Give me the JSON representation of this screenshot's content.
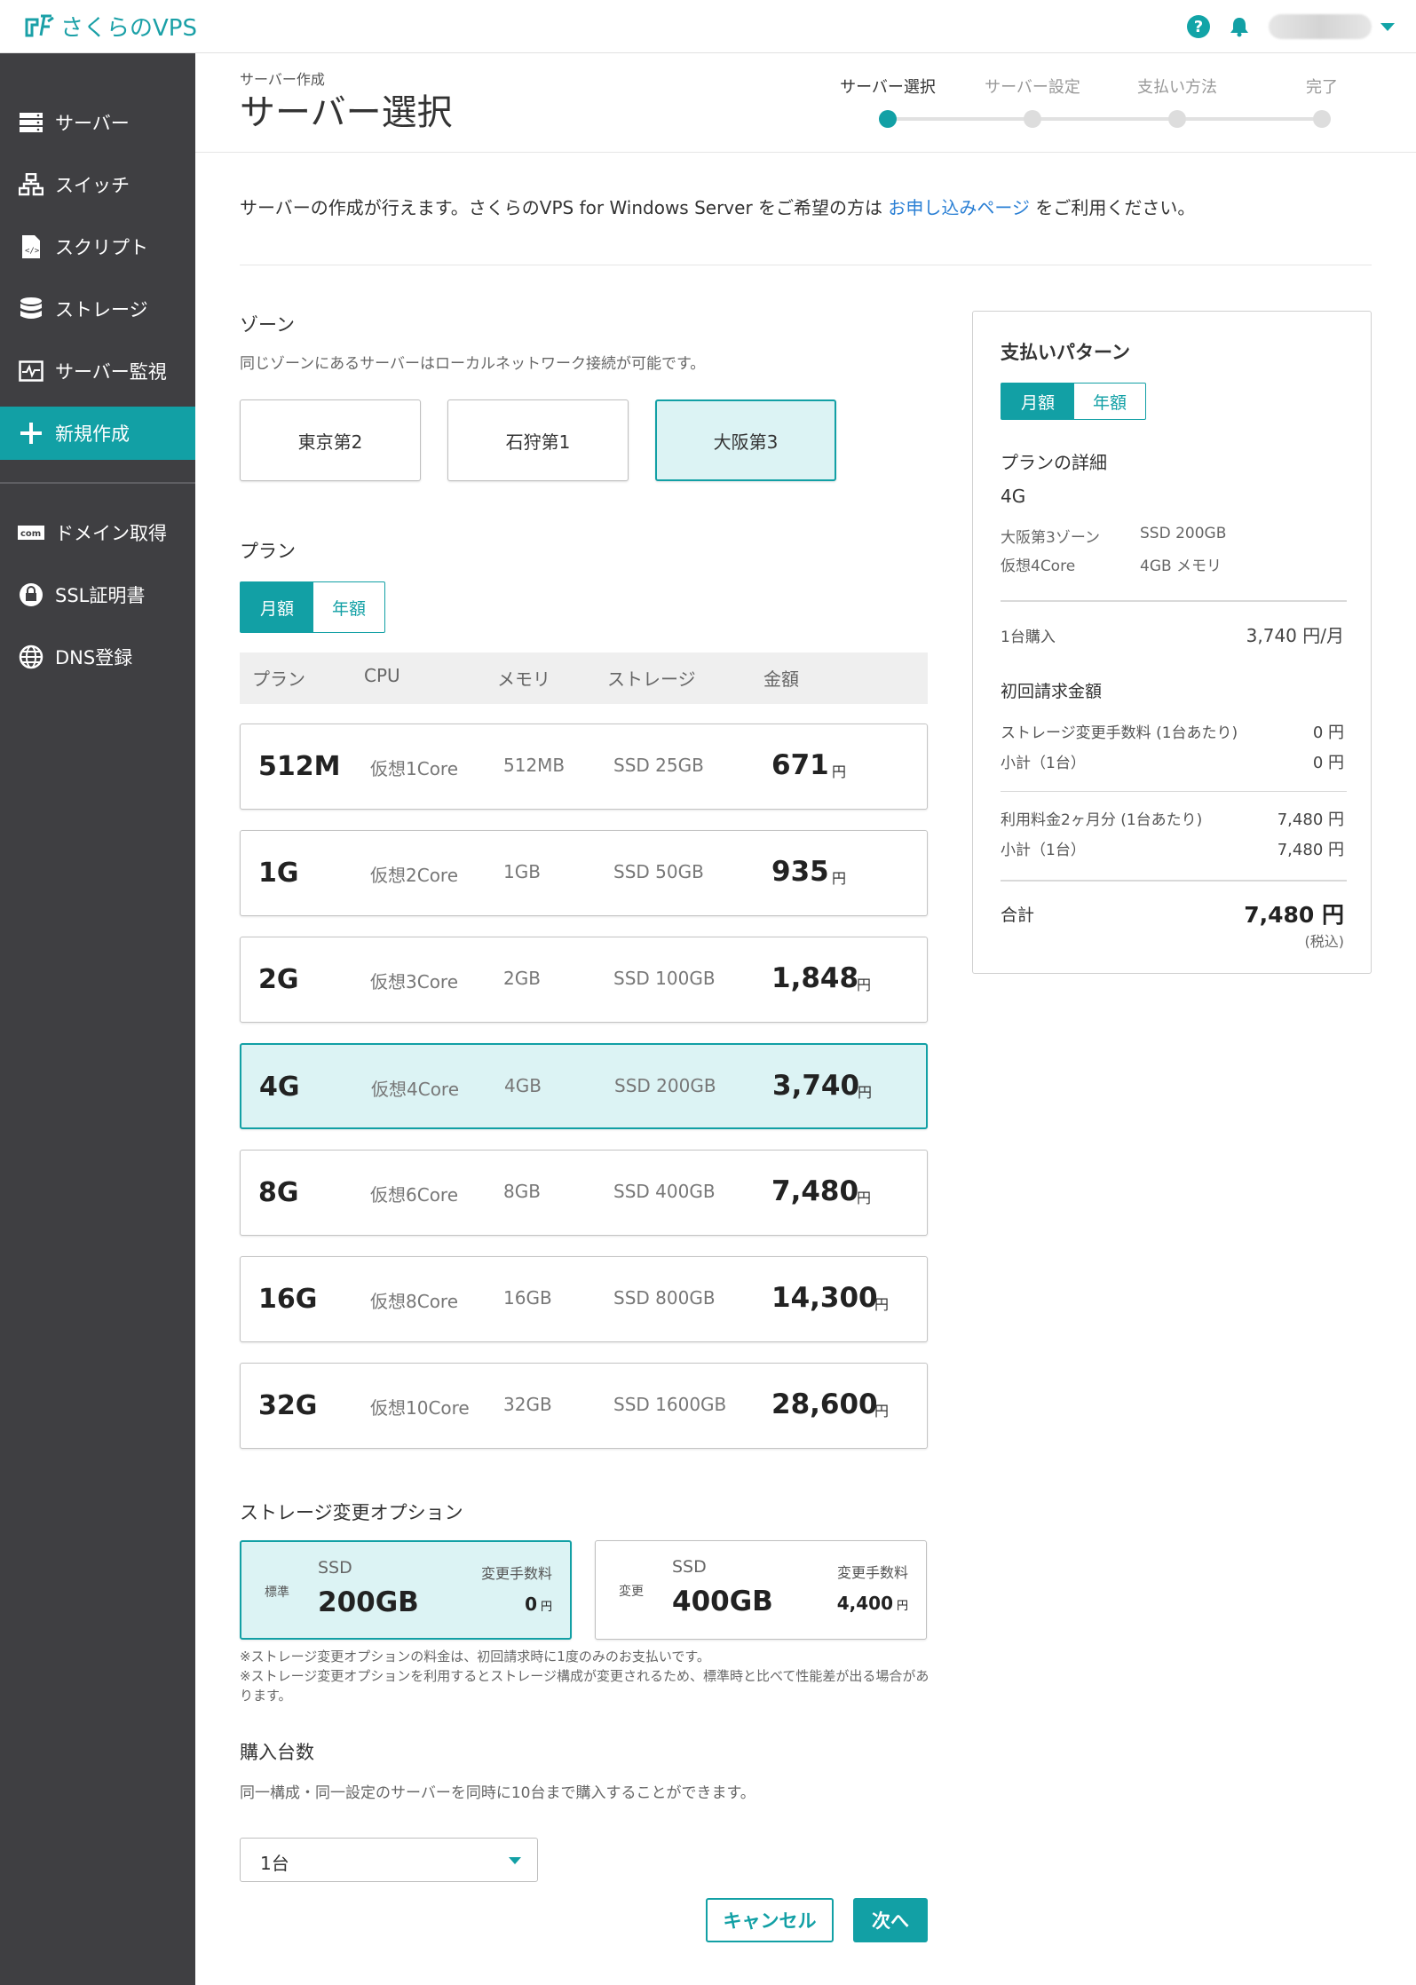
{
  "header": {
    "app_title": "さくらのVPS"
  },
  "sidebar": {
    "items": [
      {
        "label": "サーバー"
      },
      {
        "label": "スイッチ"
      },
      {
        "label": "スクリプト"
      },
      {
        "label": "ストレージ"
      },
      {
        "label": "サーバー監視"
      },
      {
        "label": "新規作成"
      },
      {
        "label": "ドメイン取得"
      },
      {
        "label": "SSL証明書"
      },
      {
        "label": "DNS登録"
      }
    ]
  },
  "page": {
    "breadcrumb": "サーバー作成",
    "title": "サーバー選択"
  },
  "steps": [
    {
      "label": "サーバー選択"
    },
    {
      "label": "サーバー設定"
    },
    {
      "label": "支払い方法"
    },
    {
      "label": "完了"
    }
  ],
  "intro": {
    "before": "サーバーの作成が行えます。さくらのVPS for Windows Server をご希望の方は ",
    "link": "お申し込みページ",
    "after": " をご利用ください。"
  },
  "zone": {
    "title": "ゾーン",
    "description": "同じゾーンにあるサーバーはローカルネットワーク接続が可能です。",
    "options": [
      {
        "label": "東京第2"
      },
      {
        "label": "石狩第1"
      },
      {
        "label": "大阪第3"
      }
    ],
    "selected": "大阪第3"
  },
  "plan": {
    "title": "プラン",
    "billing_toggle": {
      "monthly": "月額",
      "yearly": "年額"
    },
    "columns": {
      "plan": "プラン",
      "cpu": "CPU",
      "memory": "メモリ",
      "storage": "ストレージ",
      "price": "金額"
    },
    "rows": [
      {
        "name": "512M",
        "cpu": "仮想1Core",
        "memory": "512MB",
        "storage": "SSD 25GB",
        "price": "671",
        "unit": "円"
      },
      {
        "name": "1G",
        "cpu": "仮想2Core",
        "memory": "1GB",
        "storage": "SSD 50GB",
        "price": "935",
        "unit": "円"
      },
      {
        "name": "2G",
        "cpu": "仮想3Core",
        "memory": "2GB",
        "storage": "SSD 100GB",
        "price": "1,848",
        "unit": "円"
      },
      {
        "name": "4G",
        "cpu": "仮想4Core",
        "memory": "4GB",
        "storage": "SSD 200GB",
        "price": "3,740",
        "unit": "円"
      },
      {
        "name": "8G",
        "cpu": "仮想6Core",
        "memory": "8GB",
        "storage": "SSD 400GB",
        "price": "7,480",
        "unit": "円"
      },
      {
        "name": "16G",
        "cpu": "仮想8Core",
        "memory": "16GB",
        "storage": "SSD 800GB",
        "price": "14,300",
        "unit": "円"
      },
      {
        "name": "32G",
        "cpu": "仮想10Core",
        "memory": "32GB",
        "storage": "SSD 1600GB",
        "price": "28,600",
        "unit": "円"
      }
    ],
    "selected": "4G"
  },
  "storage_option": {
    "title": "ストレージ変更オプション",
    "options": [
      {
        "tag": "標準",
        "type": "SSD",
        "size": "200GB",
        "fee_label": "変更手数料",
        "fee": "0",
        "unit": "円"
      },
      {
        "tag": "変更",
        "type": "SSD",
        "size": "400GB",
        "fee_label": "変更手数料",
        "fee": "4,400",
        "unit": "円"
      }
    ],
    "notes": [
      "※ストレージ変更オプションの料金は、初回請求時に1度のみのお支払いです。",
      "※ストレージ変更オプションを利用するとストレージ構成が変更されるため、標準時と比べて性能差が出る場合があります。"
    ]
  },
  "quantity": {
    "title": "購入台数",
    "description": "同一構成・同一設定のサーバーを同時に10台まで購入することができます。",
    "value": "1台"
  },
  "buttons": {
    "cancel": "キャンセル",
    "next": "次へ"
  },
  "payment": {
    "title": "支払いパターン",
    "toggle": {
      "monthly": "月額",
      "yearly": "年額"
    },
    "details_title": "プランの詳細",
    "plan_name": "4G",
    "zone": "大阪第3ゾーン",
    "storage": "SSD 200GB",
    "cpu": "仮想4Core",
    "memory": "4GB メモリ",
    "purchase_label": "1台購入",
    "purchase_value": "3,740 円/月",
    "initial_title": "初回請求金額",
    "storage_fee_label": "ストレージ変更手数料 (1台あたり)",
    "storage_fee_value": "0 円",
    "subtotal_label_1": "小計（1台）",
    "subtotal_value_1": "0 円",
    "usage_label": "利用料金2ヶ月分 (1台あたり)",
    "usage_value": "7,480 円",
    "subtotal_label_2": "小計（1台）",
    "subtotal_value_2": "7,480 円",
    "total_label": "合計",
    "total_value": "7,480 円",
    "tax_note": "(税込)"
  },
  "colors": {
    "accent": "#12a0a5",
    "sidebar": "#3f3f42",
    "selected_bg": "#dcf3f4",
    "link": "#2a7fd4"
  }
}
